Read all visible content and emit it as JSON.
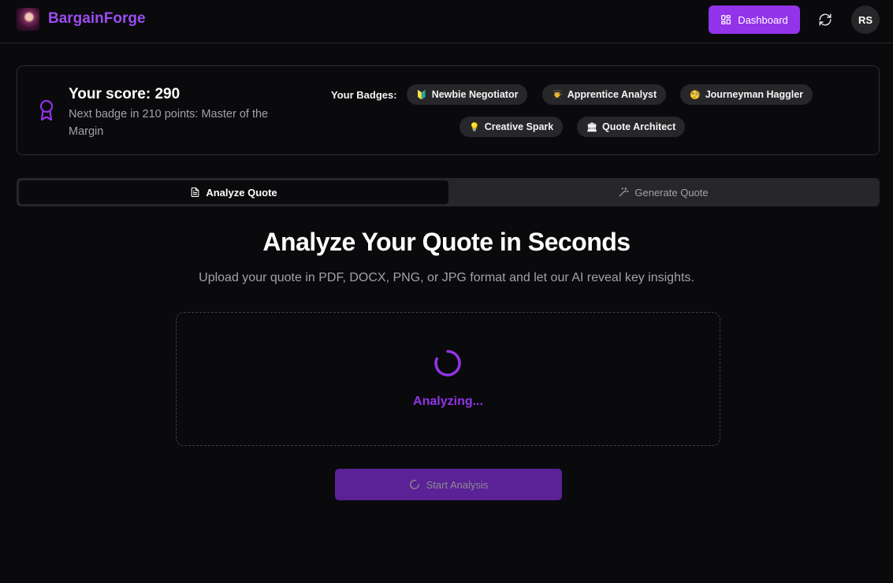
{
  "header": {
    "brand": "BargainForge",
    "dashboard_label": "Dashboard",
    "avatar_initials": "RS"
  },
  "score_card": {
    "score_text": "Your score: 290",
    "next_badge_text": "Next badge in 210 points: Master of the Margin",
    "badges_label": "Your Badges:",
    "badges": [
      {
        "emoji": "🔰",
        "label": "Newbie Negotiator"
      },
      {
        "emoji": "👨‍🎓",
        "label": "Apprentice Analyst"
      },
      {
        "emoji": "🧐",
        "label": "Journeyman Haggler"
      },
      {
        "emoji": "💡",
        "label": "Creative Spark"
      },
      {
        "emoji": "🏛",
        "label": "Quote Architect"
      }
    ]
  },
  "tabs": [
    {
      "label": "Analyze Quote",
      "icon": "file-text-icon",
      "active": true
    },
    {
      "label": "Generate Quote",
      "icon": "wand-icon",
      "active": false
    }
  ],
  "main": {
    "title": "Analyze Your Quote in Seconds",
    "subtitle": "Upload your quote in PDF, DOCX, PNG, or JPG format and let our AI reveal key insights.",
    "status_text": "Analyzing...",
    "start_button_label": "Start Analysis"
  },
  "colors": {
    "accent": "#9333ea",
    "background": "#0a0a0c",
    "card_border": "#2e2e33",
    "badge_bg": "#27272a"
  }
}
